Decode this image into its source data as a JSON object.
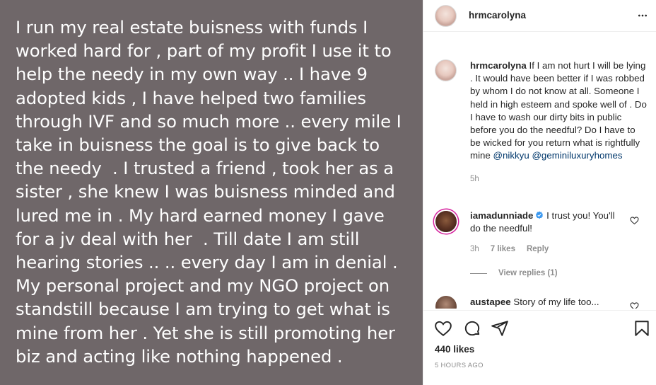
{
  "post": {
    "text": "I run my real estate buisness with funds I worked hard for , part of my profit I use it to help the needy in my own way .. I have 9 adopted kids , I have helped two families through IVF and so much more .. every mile I take in buisness the goal is to give back to the needy  . I trusted a friend , took her as a sister , she knew I was buisness minded and lured me in . My hard earned money I gave  for a jv deal with her  . Till date I am still hearing stories .. .. every day I am in denial . My personal project and my NGO project on standstill because I am trying to get what is mine from her . Yet she is still promoting her biz and acting like nothing happened .",
    "background_color": "#6f6769"
  },
  "header": {
    "username": "hrmcarolyna",
    "more_icon": "more-horizontal-icon"
  },
  "caption": {
    "username": "hrmcarolyna",
    "text": "If I am not hurt I will be lying . It would have been better if I was robbed by whom I do not know at all. Someone I held in high esteem and spoke well of . Do I have to wash our dirty bits in public before you do the needful? Do I have to be wicked for you return what is rightfully mine",
    "mention1": "@nikkyu",
    "mention2": "@geminiluxuryhomes",
    "time": "5h"
  },
  "comments": [
    {
      "username": "iamadunniade",
      "verified": true,
      "text": "I trust you! You'll do the needful!",
      "time": "3h",
      "likes": "7 likes",
      "reply": "Reply",
      "view_replies": "View replies (1)"
    },
    {
      "username": "austapee",
      "text": "Story of my life too..."
    }
  ],
  "actions": {
    "icons": [
      "heart-icon",
      "comment-icon",
      "share-icon",
      "bookmark-icon"
    ],
    "likes": "440 likes",
    "posted": "5 HOURS AGO"
  },
  "colors": {
    "link": "#00376b",
    "muted": "#8e8e8e",
    "verified": "#3897f0"
  }
}
